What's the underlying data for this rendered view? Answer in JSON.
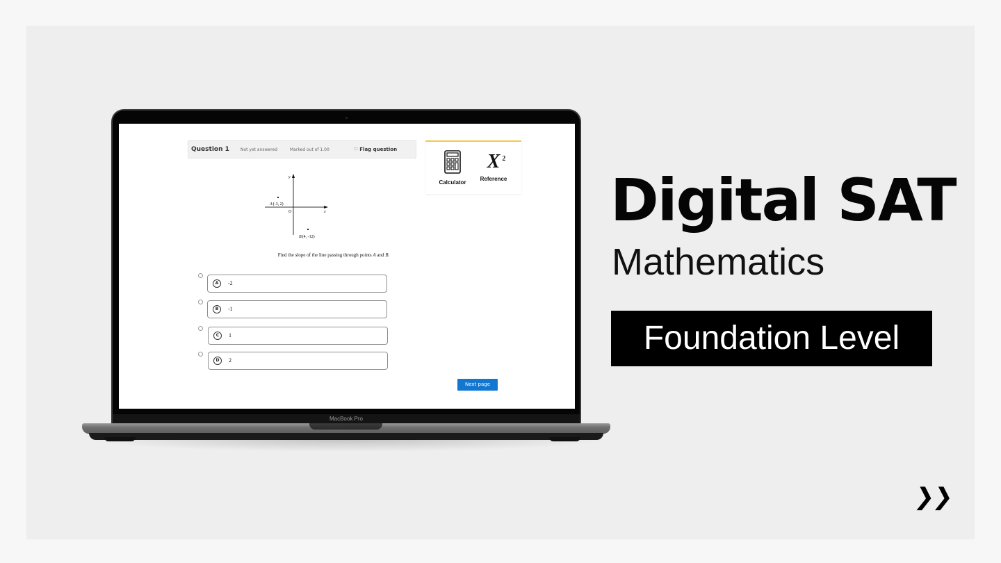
{
  "device": {
    "brand_label": "MacBook Pro"
  },
  "quiz": {
    "question_label": "Question 1",
    "status": "Not yet answered",
    "marks": "Marked out of 1.00",
    "flag_icon": "flag-icon",
    "flag_label": "Flag question",
    "tools": [
      {
        "icon": "calculator-icon",
        "label": "Calculator"
      },
      {
        "icon": "x-squared-icon",
        "symbol": "X",
        "superscript": "2",
        "label": "Reference"
      }
    ],
    "figure": {
      "y_axis_label": "y",
      "x_axis_label": "x",
      "origin_label": "O",
      "point_a": {
        "name": "A",
        "coords": "(-3, 2)"
      },
      "point_b": {
        "name": "B",
        "coords": "(4, -12)"
      }
    },
    "stem": {
      "prefix": "Find the slope of the line passing through points ",
      "a": "A",
      "middle": " and ",
      "b": "B",
      "suffix": "."
    },
    "options": [
      {
        "letter": "A",
        "value": "-2"
      },
      {
        "letter": "B",
        "value": "-1"
      },
      {
        "letter": "C",
        "value": "1"
      },
      {
        "letter": "D",
        "value": "2"
      }
    ],
    "next_label": "Next page"
  },
  "promo": {
    "title": "Digital SAT",
    "subtitle": "Mathematics",
    "level": "Foundation Level",
    "chevron_icon": "double-chevron-right-icon",
    "chevron_glyph": "❯❯"
  },
  "colors": {
    "background": "#f7f7f7",
    "panel": "#eeeeee",
    "accent_button": "#1177d1",
    "tool_accent": "#f2c94c",
    "badge": "#000000"
  }
}
